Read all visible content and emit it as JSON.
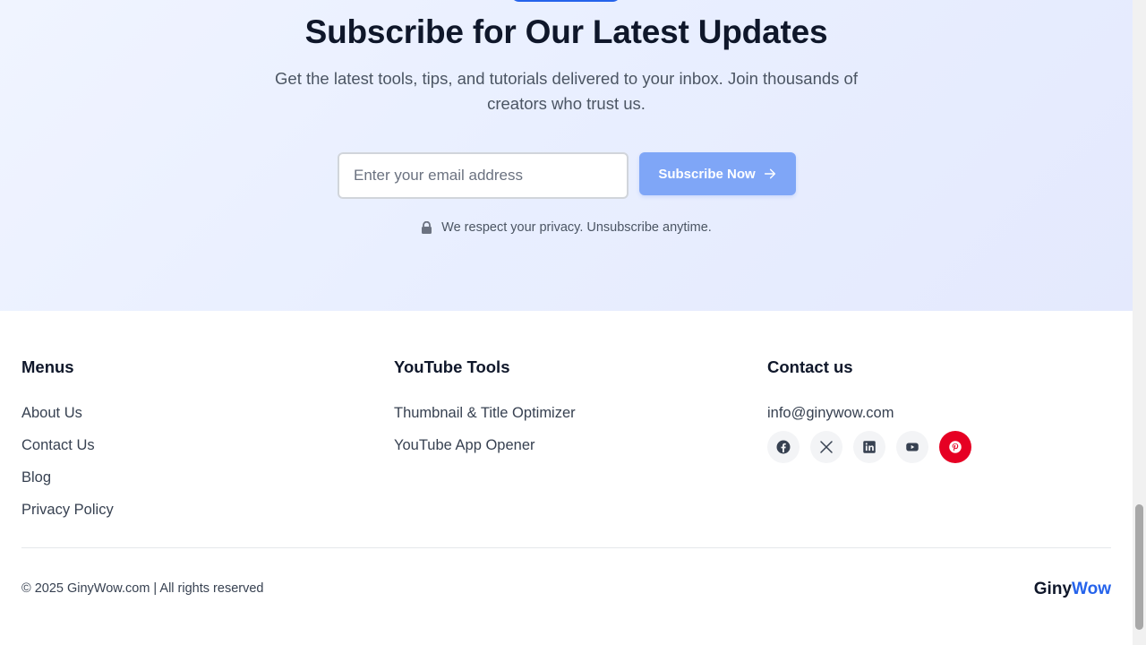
{
  "subscribe": {
    "title": "Subscribe for Our Latest Updates",
    "description": "Get the latest tools, tips, and tutorials delivered to your inbox. Join thousands of creators who trust us.",
    "email_placeholder": "Enter your email address",
    "email_value": "",
    "button_label": "Subscribe Now",
    "privacy_note": "We respect your privacy. Unsubscribe anytime."
  },
  "footer": {
    "menus": {
      "heading": "Menus",
      "links": [
        "About Us",
        "Contact Us",
        "Blog",
        "Privacy Policy"
      ]
    },
    "youtube_tools": {
      "heading": "YouTube Tools",
      "links": [
        "Thumbnail & Title Optimizer",
        "YouTube App Opener"
      ]
    },
    "contact": {
      "heading": "Contact us",
      "email": "info@ginywow.com",
      "socials": [
        "facebook-icon",
        "x-icon",
        "linkedin-icon",
        "youtube-icon",
        "pinterest-icon"
      ]
    },
    "copyright": "© 2025 GinyWow.com | All rights reserved",
    "brand": {
      "part1": "Giny",
      "part2": "Wow"
    }
  },
  "colors": {
    "accent": "#2563eb",
    "button_bg": "#7fa6f7",
    "pinterest": "#e60023",
    "heading": "#0f172a"
  }
}
